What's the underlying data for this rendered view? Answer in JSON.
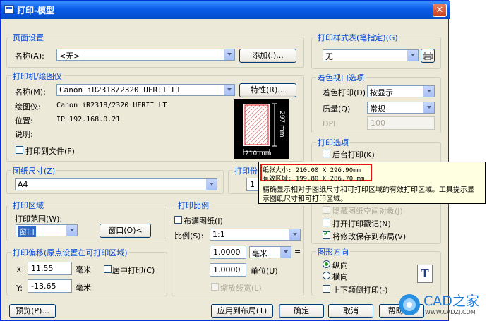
{
  "window": {
    "title": "打印-模型",
    "close_glyph": "✕"
  },
  "page_setup": {
    "group_title": "页面设置",
    "name_label": "名称(A):",
    "name_value": "<无>",
    "add_button": "添加(.)..."
  },
  "printer": {
    "group_title": "打印机/绘图仪",
    "name_label": "名称(M):",
    "name_value": "Canon iR2318/2320 UFRII LT",
    "properties_button": "特性(R)...",
    "plotter_label": "绘图仪:",
    "plotter_value": "Canon iR2318/2320 UFRII LT",
    "location_label": "位置:",
    "location_value": "IP_192.168.0.21",
    "description_label": "说明:",
    "print_to_file": "打印到文件(F)",
    "preview_width": "210 mm",
    "preview_height": "297 mm"
  },
  "paper_size": {
    "group_title": "图纸尺寸(Z)",
    "value": "A4"
  },
  "copies": {
    "group_title": "打印份数",
    "value": "1"
  },
  "print_area": {
    "group_title": "打印区域",
    "range_label": "打印范围(W):",
    "range_value": "窗口",
    "window_button": "窗口(O)<"
  },
  "print_offset": {
    "group_title": "打印偏移(原点设置在可打印区域)",
    "x_label": "X:",
    "x_value": "11.55",
    "x_unit": "毫米",
    "y_label": "Y:",
    "y_value": "-13.65",
    "y_unit": "毫米",
    "center_plot": "居中打印(C)"
  },
  "print_scale": {
    "group_title": "打印比例",
    "fit_paper": "布满图纸(I)",
    "scale_label": "比例(S):",
    "scale_value": "1:1",
    "value1": "1.0000",
    "unit1": "毫米",
    "equals": "=",
    "value2": "1.0000",
    "unit2": "单位(U)",
    "lineweights": "缩放线宽(L)"
  },
  "plot_style": {
    "group_title": "打印样式表(笔指定)(G)",
    "value": "无"
  },
  "shaded_viewport": {
    "group_title": "着色视口选项",
    "shade_label": "着色打印(D)",
    "shade_value": "按显示",
    "quality_label": "质量(Q)",
    "quality_value": "常规",
    "dpi_label": "DPI",
    "dpi_value": "100"
  },
  "plot_options": {
    "group_title": "打印选项",
    "background": "后台打印(K)",
    "hide_objects": "隐藏图纸空间对象(J)",
    "stamp": "打开打印戳记(N)",
    "save_changes": "将修改保存到布局(V)"
  },
  "orientation": {
    "group_title": "图形方向",
    "portrait": "纵向",
    "landscape": "横向",
    "upside_down": "上下颠倒打印(-)",
    "icon_letter": "T"
  },
  "tooltip": {
    "line1": "纸张大小: 210.00 X 296.90mm",
    "line2": "有效区域: 199.80 X 286.70 mm",
    "line3": "精确显示相对于图纸尺寸和可打印区域的有效打印区域。工具提示显",
    "line4": "示图纸尺寸和可打印区域。"
  },
  "footer": {
    "preview_button": "预览(P)...",
    "apply_button": "应用到布局(T)",
    "ok_button": "确定",
    "cancel_button": "取消",
    "help_button": "帮助(H)"
  },
  "watermark": {
    "logo_text": "CAD之家",
    "url": "WWW.CADZJ.COM"
  }
}
